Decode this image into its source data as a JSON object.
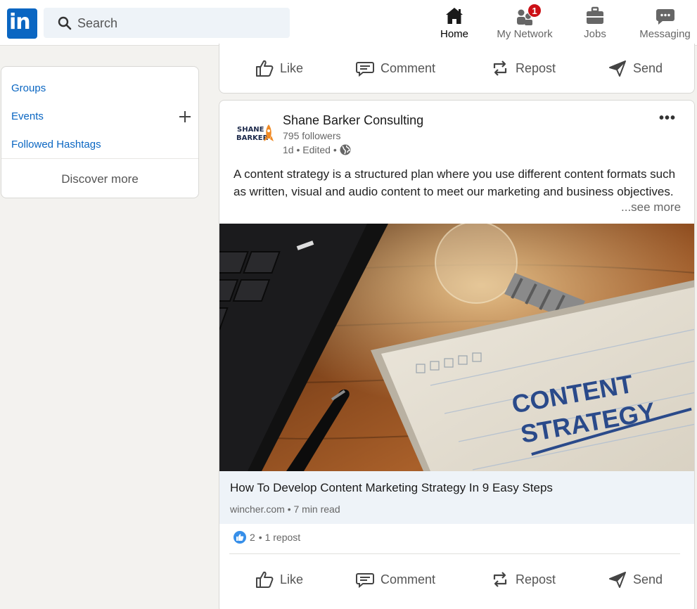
{
  "nav": {
    "logo_text": "in",
    "search_placeholder": "Search",
    "items": [
      {
        "label": "Home"
      },
      {
        "label": "My Network",
        "badge": "1"
      },
      {
        "label": "Jobs"
      },
      {
        "label": "Messaging"
      }
    ]
  },
  "sidebar": {
    "links": [
      "Groups",
      "Events",
      "Followed Hashtags"
    ],
    "discover": "Discover more"
  },
  "actions": {
    "like": "Like",
    "comment": "Comment",
    "repost": "Repost",
    "send": "Send"
  },
  "post": {
    "company": "Shane Barker Consulting",
    "logo_text_1": "SHANE",
    "logo_text_2": "BARKER",
    "followers": "795 followers",
    "meta": "1d • Edited •",
    "text": "A content strategy is a structured plan where you use different content formats such as written, visual and audio content to meet our marketing and business objectives.",
    "see_more": "...see more",
    "image_text_1": "CONTENT",
    "image_text_2": "STRATEGY",
    "link_title": "How To Develop Content Marketing Strategy In 9 Easy Steps",
    "link_source": "wincher.com • 7 min read",
    "reactions_count": "2",
    "reposts": "• 1 repost"
  },
  "colors": {
    "brand": "#0a66c2",
    "badge": "#cc1016",
    "background": "#f3f2ef"
  }
}
